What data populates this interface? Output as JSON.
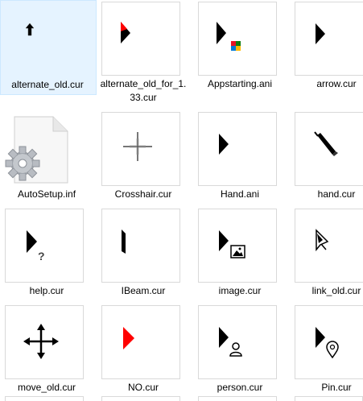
{
  "files": [
    {
      "name": "alternate_old.cur",
      "icon": "up-arrow-cursor-icon",
      "selected": true
    },
    {
      "name": "alternate_old_for_1.33.cur",
      "icon": "red-tipped-arrow-cursor-icon"
    },
    {
      "name": "Appstarting.ani",
      "icon": "app-starting-cursor-icon"
    },
    {
      "name": "arrow.cur",
      "icon": "arrow-cursor-icon"
    },
    {
      "name": "AutoSetup.inf",
      "icon": "settings-file-icon"
    },
    {
      "name": "Crosshair.cur",
      "icon": "crosshair-cursor-icon"
    },
    {
      "name": "Hand.ani",
      "icon": "arrow-cursor-icon"
    },
    {
      "name": "hand.cur",
      "icon": "pen-cursor-icon"
    },
    {
      "name": "help.cur",
      "icon": "help-cursor-icon"
    },
    {
      "name": "IBeam.cur",
      "icon": "ibeam-cursor-icon"
    },
    {
      "name": "image.cur",
      "icon": "image-cursor-icon"
    },
    {
      "name": "link_old.cur",
      "icon": "link-arrow-cursor-icon"
    },
    {
      "name": "move_old.cur",
      "icon": "move-cursor-icon"
    },
    {
      "name": "NO.cur",
      "icon": "red-arrow-cursor-icon"
    },
    {
      "name": "person.cur",
      "icon": "person-cursor-icon"
    },
    {
      "name": "Pin.cur",
      "icon": "pin-cursor-icon"
    }
  ],
  "colors": {
    "selection_bg": "#e5f3ff",
    "selection_border": "#cce8ff",
    "thumbnail_border": "#d9d9d9",
    "cursor_black": "#000000",
    "accent_red": "#ff0000"
  }
}
